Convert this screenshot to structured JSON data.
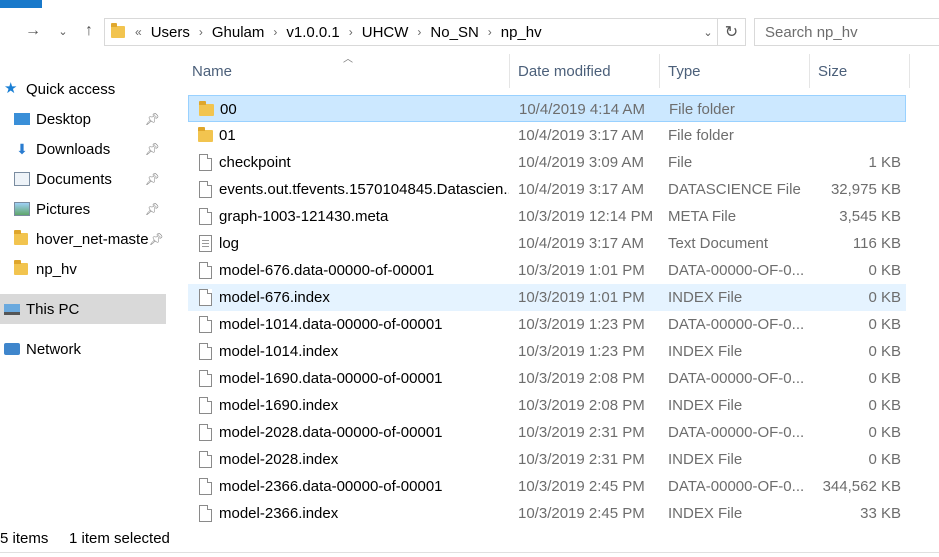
{
  "address": {
    "overflow_glyph": "«",
    "crumbs": [
      "Users",
      "Ghulam",
      "v1.0.0.1",
      "UHCW",
      "No_SN",
      "np_hv"
    ],
    "search_placeholder": "Search np_hv"
  },
  "nav": {
    "quick_access": "Quick access",
    "items": [
      {
        "label": "Desktop"
      },
      {
        "label": "Downloads"
      },
      {
        "label": "Documents"
      },
      {
        "label": "Pictures"
      },
      {
        "label": "hover_net-maste"
      },
      {
        "label": "np_hv"
      }
    ],
    "this_pc": "This PC",
    "network": "Network"
  },
  "columns": {
    "name": "Name",
    "date": "Date modified",
    "type": "Type",
    "size": "Size"
  },
  "files": [
    {
      "name": "00",
      "date": "10/4/2019 4:14 AM",
      "type": "File folder",
      "size": "",
      "icon": "folder-icon"
    },
    {
      "name": "01",
      "date": "10/4/2019 3:17 AM",
      "type": "File folder",
      "size": "",
      "icon": "folder-icon"
    },
    {
      "name": "checkpoint",
      "date": "10/4/2019 3:09 AM",
      "type": "File",
      "size": "1 KB",
      "icon": "file-icon"
    },
    {
      "name": "events.out.tfevents.1570104845.Datascien...",
      "date": "10/4/2019 3:17 AM",
      "type": "DATASCIENCE File",
      "size": "32,975 KB",
      "icon": "file-icon"
    },
    {
      "name": "graph-1003-121430.meta",
      "date": "10/3/2019 12:14 PM",
      "type": "META File",
      "size": "3,545 KB",
      "icon": "file-icon"
    },
    {
      "name": "log",
      "date": "10/4/2019 3:17 AM",
      "type": "Text Document",
      "size": "116 KB",
      "icon": "text-icon"
    },
    {
      "name": "model-676.data-00000-of-00001",
      "date": "10/3/2019 1:01 PM",
      "type": "DATA-00000-OF-0...",
      "size": "0 KB",
      "icon": "file-icon"
    },
    {
      "name": "model-676.index",
      "date": "10/3/2019 1:01 PM",
      "type": "INDEX File",
      "size": "0 KB",
      "icon": "file-icon"
    },
    {
      "name": "model-1014.data-00000-of-00001",
      "date": "10/3/2019 1:23 PM",
      "type": "DATA-00000-OF-0...",
      "size": "0 KB",
      "icon": "file-icon"
    },
    {
      "name": "model-1014.index",
      "date": "10/3/2019 1:23 PM",
      "type": "INDEX File",
      "size": "0 KB",
      "icon": "file-icon"
    },
    {
      "name": "model-1690.data-00000-of-00001",
      "date": "10/3/2019 2:08 PM",
      "type": "DATA-00000-OF-0...",
      "size": "0 KB",
      "icon": "file-icon"
    },
    {
      "name": "model-1690.index",
      "date": "10/3/2019 2:08 PM",
      "type": "INDEX File",
      "size": "0 KB",
      "icon": "file-icon"
    },
    {
      "name": "model-2028.data-00000-of-00001",
      "date": "10/3/2019 2:31 PM",
      "type": "DATA-00000-OF-0...",
      "size": "0 KB",
      "icon": "file-icon"
    },
    {
      "name": "model-2028.index",
      "date": "10/3/2019 2:31 PM",
      "type": "INDEX File",
      "size": "0 KB",
      "icon": "file-icon"
    },
    {
      "name": "model-2366.data-00000-of-00001",
      "date": "10/3/2019 2:45 PM",
      "type": "DATA-00000-OF-0...",
      "size": "344,562 KB",
      "icon": "file-icon"
    },
    {
      "name": "model-2366.index",
      "date": "10/3/2019 2:45 PM",
      "type": "INDEX File",
      "size": "33 KB",
      "icon": "file-icon"
    }
  ],
  "status": {
    "count": "5 items",
    "selected": "1 item selected"
  },
  "colors": {
    "selected_row": "#cce8ff",
    "hover_row": "#e5f3ff",
    "folder": "#f2c44f",
    "header_text": "#4c607a"
  }
}
